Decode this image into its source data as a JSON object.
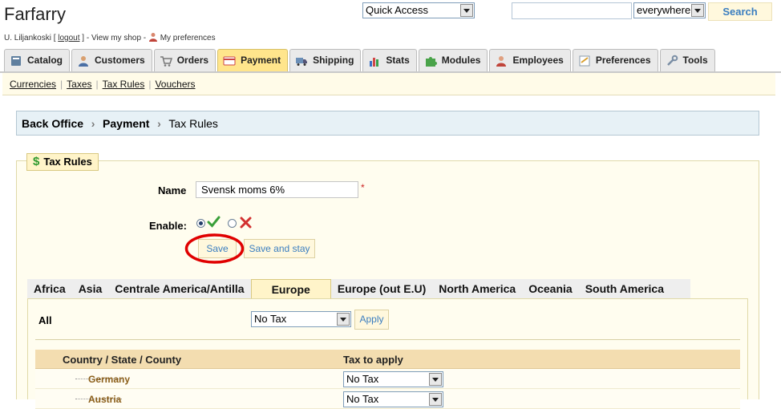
{
  "header": {
    "shop_name": "Farfarry",
    "user_prefix": "U. Liljankoski [ ",
    "logout": "logout",
    "user_mid": " ] - View my shop - ",
    "my_preferences": "My preferences",
    "quick_access": "Quick Access",
    "search_value": "",
    "search_scope": "everywhere",
    "search_button": "Search"
  },
  "tabs": [
    {
      "label": "Catalog",
      "icon": "book-icon"
    },
    {
      "label": "Customers",
      "icon": "person-icon"
    },
    {
      "label": "Orders",
      "icon": "cart-icon"
    },
    {
      "label": "Payment",
      "icon": "payment-card-icon",
      "active": true
    },
    {
      "label": "Shipping",
      "icon": "truck-icon"
    },
    {
      "label": "Stats",
      "icon": "bar-chart-icon"
    },
    {
      "label": "Modules",
      "icon": "puzzle-icon"
    },
    {
      "label": "Employees",
      "icon": "employee-icon"
    },
    {
      "label": "Preferences",
      "icon": "preferences-form-icon"
    },
    {
      "label": "Tools",
      "icon": "wrench-icon"
    }
  ],
  "subnav": [
    "Currencies",
    "Taxes",
    "Tax Rules",
    "Vouchers"
  ],
  "breadcrumb": [
    "Back Office",
    "Payment",
    "Tax Rules"
  ],
  "form": {
    "legend": "Tax Rules",
    "legend_icon": "$",
    "name_label": "Name",
    "name_value": "Svensk moms 6%",
    "required_mark": "*",
    "enable_label": "Enable:",
    "enabled": true,
    "save": "Save",
    "save_and_stay": "Save and stay"
  },
  "zones": {
    "tabs": [
      "Africa",
      "Asia",
      "Centrale America/Antilla",
      "Europe",
      "Europe (out E.U)",
      "North America",
      "Oceania",
      "South America"
    ],
    "active": "Europe",
    "all_label": "All",
    "all_value": "No Tax",
    "apply": "Apply",
    "columns": [
      "Country / State / County",
      "Tax to apply"
    ],
    "rows": [
      {
        "country": "Germany",
        "tax": "No Tax"
      },
      {
        "country": "Austria",
        "tax": "No Tax"
      }
    ]
  },
  "colors": {
    "active_tab": "#ffe58c",
    "highlight_ring": "#e00000",
    "link_blue": "#3b7ec0"
  }
}
